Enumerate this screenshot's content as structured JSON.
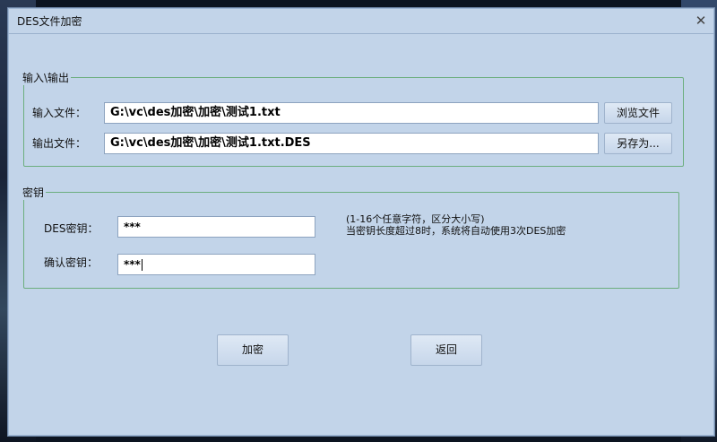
{
  "window": {
    "title": "DES文件加密",
    "close_glyph": "✕"
  },
  "io_group": {
    "legend": "输入\\输出",
    "input_label": "输入文件：",
    "input_value": "G:\\vc\\des加密\\加密\\测试1.txt",
    "browse_button": "浏览文件",
    "output_label": "输出文件：",
    "output_value": "G:\\vc\\des加密\\加密\\测试1.txt.DES",
    "save_as_button": "另存为..."
  },
  "key_group": {
    "legend": "密钥",
    "key_label": "DES密钥：",
    "key_value": "***",
    "confirm_label": "确认密钥：",
    "confirm_value": "***",
    "hint_line1": "(1-16个任意字符，区分大小写)",
    "hint_line2": "当密钥长度超过8时，系统将自动使用3次DES加密"
  },
  "actions": {
    "encrypt_button": "加密",
    "back_button": "返回"
  }
}
